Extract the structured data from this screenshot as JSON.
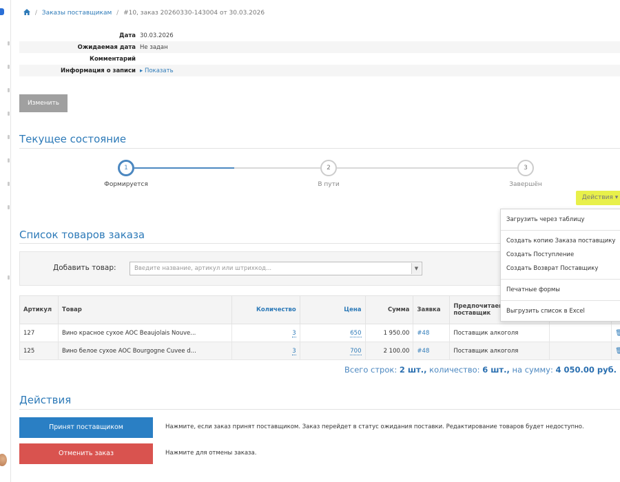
{
  "breadcrumb": {
    "home_icon": "home-icon",
    "parent": "Заказы поставщикам",
    "current": "#10, заказ 20260330-143004 от 30.03.2026"
  },
  "info": {
    "date_label": "Дата",
    "date_value": "30.03.2026",
    "expected_label": "Ожидаемая дата",
    "expected_value": "Не задан",
    "comment_label": "Комментарий",
    "comment_value": "",
    "record_label": "Информация о записи",
    "record_link": "▸ Показать"
  },
  "edit_button": "Изменить",
  "status_section": {
    "title": "Текущее состояние",
    "steps": [
      {
        "num": "1",
        "label": "Формируется"
      },
      {
        "num": "2",
        "label": "В пути"
      },
      {
        "num": "3",
        "label": "Завершён"
      }
    ]
  },
  "actions_dropdown": {
    "button": "Действия ▾",
    "items": [
      "Загрузить через таблицу",
      "Создать копию Заказа поставщику",
      "Создать Поступление",
      "Создать Возврат Поставщику",
      "Печатные формы",
      "Выгрузить список в Excel"
    ]
  },
  "goods_section": {
    "title": "Список товаров заказа",
    "add_label": "Добавить товар:",
    "add_placeholder": "Введите название, артикул или штрихкод...",
    "columns": {
      "article": "Артикул",
      "product": "Товар",
      "qty": "Количество",
      "price": "Цена",
      "sum": "Сумма",
      "request": "Заявка",
      "supplier": "Предпочитаемый поставщик"
    },
    "rows": [
      {
        "article": "127",
        "product": "Вино красное сухое AOC Beaujolais Nouve...",
        "qty": "3",
        "price": "650",
        "sum": "1 950.00",
        "request": "#48",
        "supplier": "Поставщик алкоголя"
      },
      {
        "article": "125",
        "product": "Вино белое сухое AOC Bourgogne Cuvee d...",
        "qty": "3",
        "price": "700",
        "sum": "2 100.00",
        "request": "#48",
        "supplier": "Поставщик алкоголя"
      }
    ],
    "totals": {
      "rows_text": "Всего строк:",
      "rows_value": "2 шт.,",
      "qty_text": "количество:",
      "qty_value": "6 шт.,",
      "sum_text": "на сумму:",
      "sum_value": "4 050.00 руб."
    }
  },
  "actions_section": {
    "title": "Действия",
    "accept_button": "Принят поставщиком",
    "accept_desc": "Нажмите, если заказ принят поставщиком. Заказ перейдет в статус ожидания поставки. Редактирование товаров будет недоступно.",
    "cancel_button": "Отменить заказ",
    "cancel_desc": "Нажмите для отмены заказа."
  },
  "colors": {
    "accent": "#2d7ab8",
    "accept": "#2a7fc4",
    "cancel": "#d9534f",
    "actions_highlight": "#e8f04a"
  }
}
